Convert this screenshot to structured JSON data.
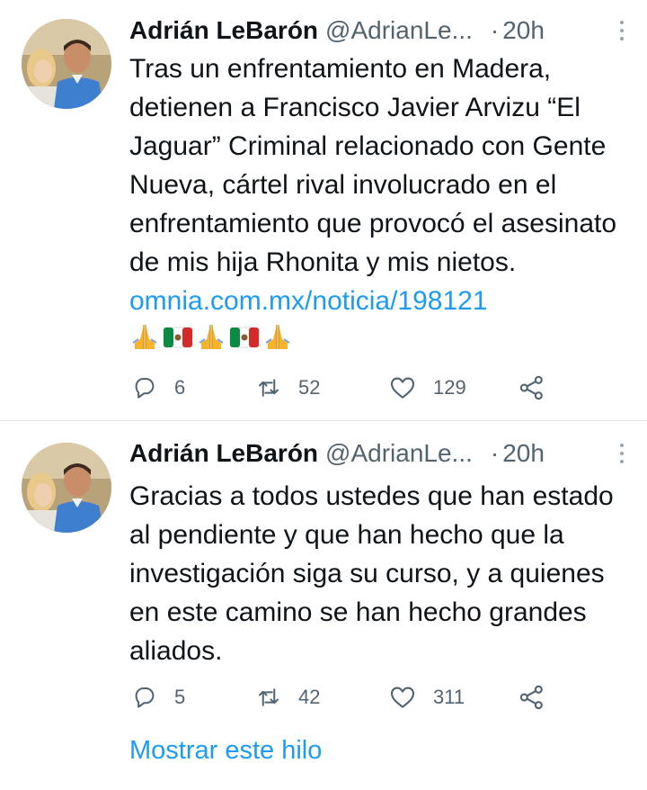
{
  "tweets": [
    {
      "author": "Adrián LeBarón",
      "handle": "@AdrianLe...",
      "separator": "·",
      "time": "20h",
      "text_before_link": "Tras un enfrentamiento en Madera, detienen a Francisco Javier Arvizu “El Jaguar” Criminal relacionado con Gente Nueva, cártel rival involucrado en el enfrentamiento que provocó el asesinato de mis hija Rhonita y mis nietos. ",
      "link": "omnia.com.mx/noticia/198121",
      "emojis": [
        "folded-hands",
        "mexico-flag",
        "folded-hands",
        "mexico-flag",
        "folded-hands"
      ],
      "replies": "6",
      "retweets": "52",
      "likes": "129"
    },
    {
      "author": "Adrián LeBarón",
      "handle": "@AdrianLe...",
      "separator": "·",
      "time": "20h",
      "text": "Gracias a todos ustedes que han estado al pendiente y que han hecho que la investigación siga su curso, y a quienes en este camino se han hecho grandes aliados.",
      "replies": "5",
      "retweets": "42",
      "likes": "311"
    }
  ],
  "show_thread": "Mostrar este hilo",
  "colors": {
    "text": "#0f1419",
    "secondary": "#536471",
    "link": "#1d9bf0",
    "divider": "#e1e6ea"
  }
}
